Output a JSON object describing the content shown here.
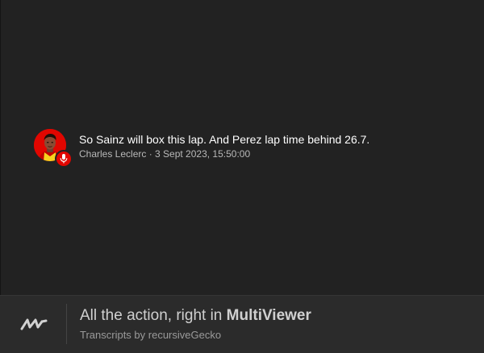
{
  "message": {
    "text": "So Sainz will box this lap. And Perez lap time behind 26.7.",
    "meta": "Charles Leclerc · 3 Sept 2023, 15:50:00",
    "avatar_icon": "driver-avatar-icon",
    "badge_icon": "microphone-icon"
  },
  "footer": {
    "headline_prefix": "All the action, right in ",
    "headline_brand": "MultiViewer",
    "credit": "Transcripts by recursiveGecko",
    "logo_icon": "multiviewer-logo-icon"
  },
  "colors": {
    "background": "#222222",
    "footer_background": "#2b2b2b",
    "accent_red": "#e10600",
    "message_text": "#ffffff",
    "meta_text": "#b9b9b9"
  }
}
